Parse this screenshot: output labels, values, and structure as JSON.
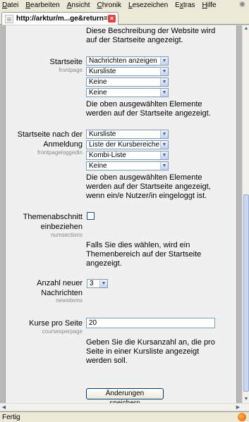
{
  "menubar": {
    "items": [
      {
        "pre": "",
        "key": "D",
        "post": "atei"
      },
      {
        "pre": "",
        "key": "B",
        "post": "earbeiten"
      },
      {
        "pre": "",
        "key": "A",
        "post": "nsicht"
      },
      {
        "pre": "",
        "key": "C",
        "post": "hronik"
      },
      {
        "pre": "",
        "key": "L",
        "post": "esezeichen"
      },
      {
        "pre": "E",
        "key": "x",
        "post": "tras"
      },
      {
        "pre": "",
        "key": "H",
        "post": "ilfe"
      }
    ]
  },
  "tab": {
    "title": "http://arktur/m...ge&return=site",
    "close": "×"
  },
  "top_desc": [
    "Diese Beschreibung der Website wird",
    "auf der Startseite angezeigt."
  ],
  "startseite": {
    "label": "Startseite",
    "sublabel": "frontpage",
    "selects": [
      "Nachrichten anzeigen",
      "Kursliste",
      "Keine",
      "Keine"
    ],
    "desc": [
      "Die oben ausgewählten Elemente",
      "werden auf der Startseite angezeigt."
    ]
  },
  "startseite_login": {
    "label": [
      "Startseite nach der",
      "Anmeldung"
    ],
    "sublabel": "frontpageloggedin",
    "selects": [
      "Kursliste",
      "Liste der Kursbereiche",
      "Kombi-Liste",
      "Keine"
    ],
    "desc": [
      "Die oben ausgewählten Elemente",
      "werden auf der Startseite angezeigt,",
      "wenn ein/e Nutzer/in eingeloggt ist."
    ]
  },
  "numsections": {
    "label": [
      "Themenabschnitt",
      "einbeziehen"
    ],
    "sublabel": "numsections",
    "checked": false,
    "desc": [
      "Falls Sie dies wählen, wird ein",
      "Themenbereich auf der Startseite",
      "angezeigt."
    ]
  },
  "newsitems": {
    "label": [
      "Anzahl neuer",
      "Nachrichten"
    ],
    "sublabel": "newsitems",
    "value": "3"
  },
  "coursesperpage": {
    "label": "Kurse pro Seite",
    "sublabel": "coursesperpage",
    "value": "20",
    "desc": [
      "Geben Sie die Kursanzahl an, die pro",
      "Seite in einer Kursliste angezeigt",
      "werden soll."
    ]
  },
  "save_label": "Änderungen speichern",
  "status": {
    "text": "Fertig"
  }
}
